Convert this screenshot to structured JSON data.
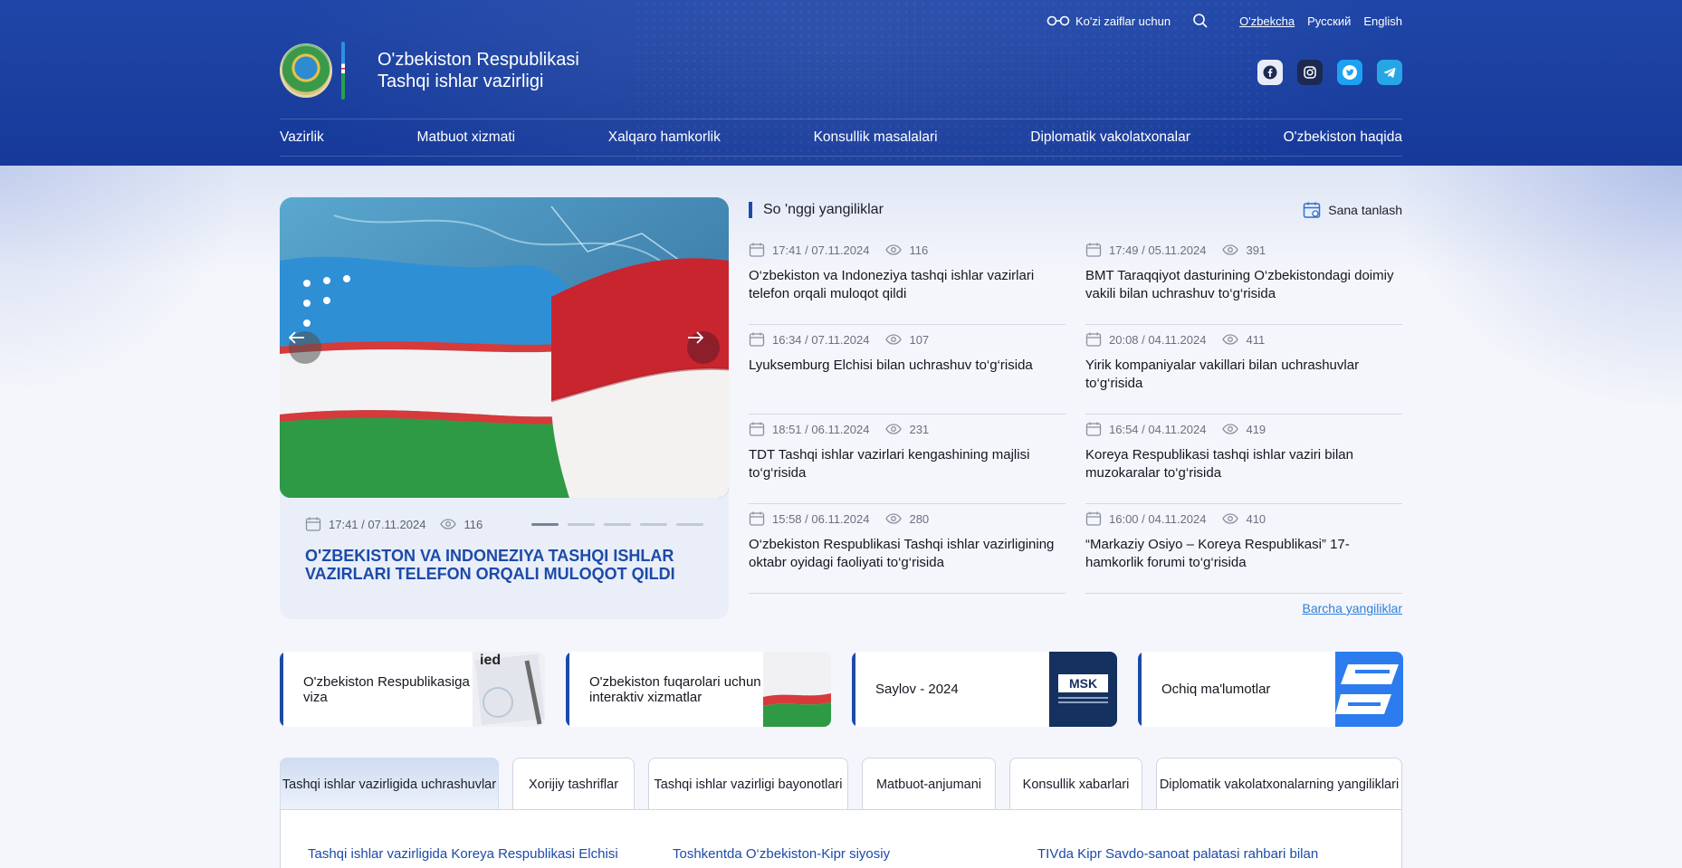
{
  "header": {
    "accessibility_label": "Ko'zi zaiflar uchun",
    "languages": [
      "O'zbekcha",
      "Русский",
      "English"
    ],
    "brand_line1": "O'zbekiston Respublikasi",
    "brand_line2": "Tashqi ishlar vazirligi",
    "nav": [
      "Vazirlik",
      "Matbuot xizmati",
      "Xalqaro hamkorlik",
      "Konsullik masalalari",
      "Diplomatik vakolatxonalar",
      "O'zbekiston haqida"
    ],
    "socials": [
      "facebook-icon",
      "instagram-icon",
      "twitter-icon",
      "telegram-icon"
    ]
  },
  "hero": {
    "datetime": "17:41 / 07.11.2024",
    "views": "116",
    "title": "O'zbekiston va Indoneziya tashqi ishlar vazirlari telefon orqali muloqot qildi",
    "slides": 5,
    "active_slide": 1
  },
  "news": {
    "heading": "So 'nggi yangiliklar",
    "date_picker": "Sana tanlash",
    "all_link": "Barcha yangiliklar",
    "items": [
      {
        "datetime": "17:41 / 07.11.2024",
        "views": "116",
        "title": "O‘zbekiston va Indoneziya tashqi ishlar vazirlari telefon orqali muloqot qildi"
      },
      {
        "datetime": "17:49 / 05.11.2024",
        "views": "391",
        "title": "BMT Taraqqiyot dasturining O‘zbekistondagi doimiy vakili bilan uchrashuv to‘g‘risida"
      },
      {
        "datetime": "16:34 / 07.11.2024",
        "views": "107",
        "title": "Lyuksemburg Elchisi bilan uchrashuv to‘g‘risida"
      },
      {
        "datetime": "20:08 / 04.11.2024",
        "views": "411",
        "title": "Yirik kompaniyalar vakillari bilan uchrashuvlar to‘g‘risida"
      },
      {
        "datetime": "18:51 / 06.11.2024",
        "views": "231",
        "title": "TDT Tashqi ishlar vazirlari kengashining majlisi to‘g‘risida"
      },
      {
        "datetime": "16:54 / 04.11.2024",
        "views": "419",
        "title": "Koreya Respublikasi tashqi ishlar vaziri bilan muzokaralar to‘g‘risida"
      },
      {
        "datetime": "15:58 / 06.11.2024",
        "views": "280",
        "title": "O‘zbekiston Respublikasi Tashqi ishlar vazirligining oktabr oyidagi faoliyati to‘g‘risida"
      },
      {
        "datetime": "16:00 / 04.11.2024",
        "views": "410",
        "title": "“Markaziy Osiyo – Koreya Respublikasi” 17-hamkorlik forumi to‘g‘risida"
      }
    ]
  },
  "cards": [
    {
      "label": "O'zbekiston Respublikasiga viza",
      "thumb_text": "ied"
    },
    {
      "label": "O'zbekiston fuqarolari uchun interaktiv xizmatlar"
    },
    {
      "label": "Saylov - 2024",
      "thumb_text": "MSK"
    },
    {
      "label": "Ochiq ma'lumotlar"
    }
  ],
  "tabs": [
    "Tashqi ishlar vazirligida uchrashuvlar",
    "Xorijiy tashriflar",
    "Tashqi ishlar vazirligi bayonotlari",
    "Matbuot-anjumani",
    "Konsullik xabarlari",
    "Diplomatik vakolatxonalarning yangiliklari"
  ],
  "panel_links": [
    "Tashqi ishlar vazirligida Koreya Respublikasi Elchisi",
    "Toshkentda O‘zbekiston-Kipr siyosiy",
    "TIVda Kipr Savdo-sanoat palatasi rahbari bilan"
  ],
  "colors": {
    "primary": "#1c4aa8",
    "header": "#1a3f9f",
    "link": "#2f7fdc"
  }
}
